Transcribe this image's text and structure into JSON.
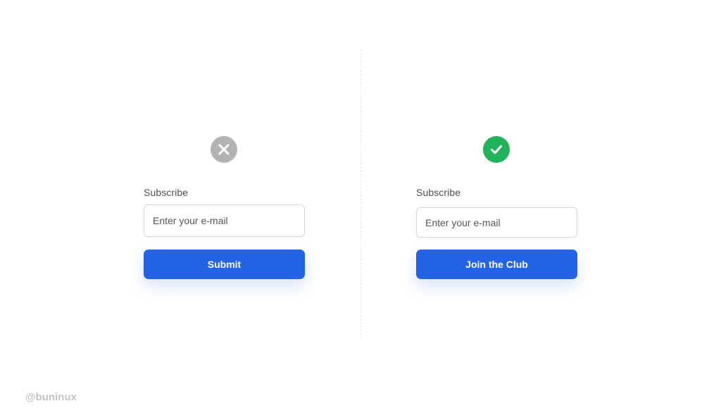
{
  "colors": {
    "button": "#2563e6",
    "bad_icon": "#b3b3b3",
    "good_icon": "#22b35a",
    "divider": "#e6e6e6"
  },
  "left_form": {
    "status_icon": "close-icon",
    "label": "Subscribe",
    "input_placeholder": "Enter your e-mail",
    "input_value": "",
    "button_label": "Submit"
  },
  "right_form": {
    "status_icon": "check-icon",
    "label": "Subscribe",
    "input_placeholder": "Enter your e-mail",
    "input_value": "",
    "button_label": "Join the Club"
  },
  "watermark": "@buninux"
}
